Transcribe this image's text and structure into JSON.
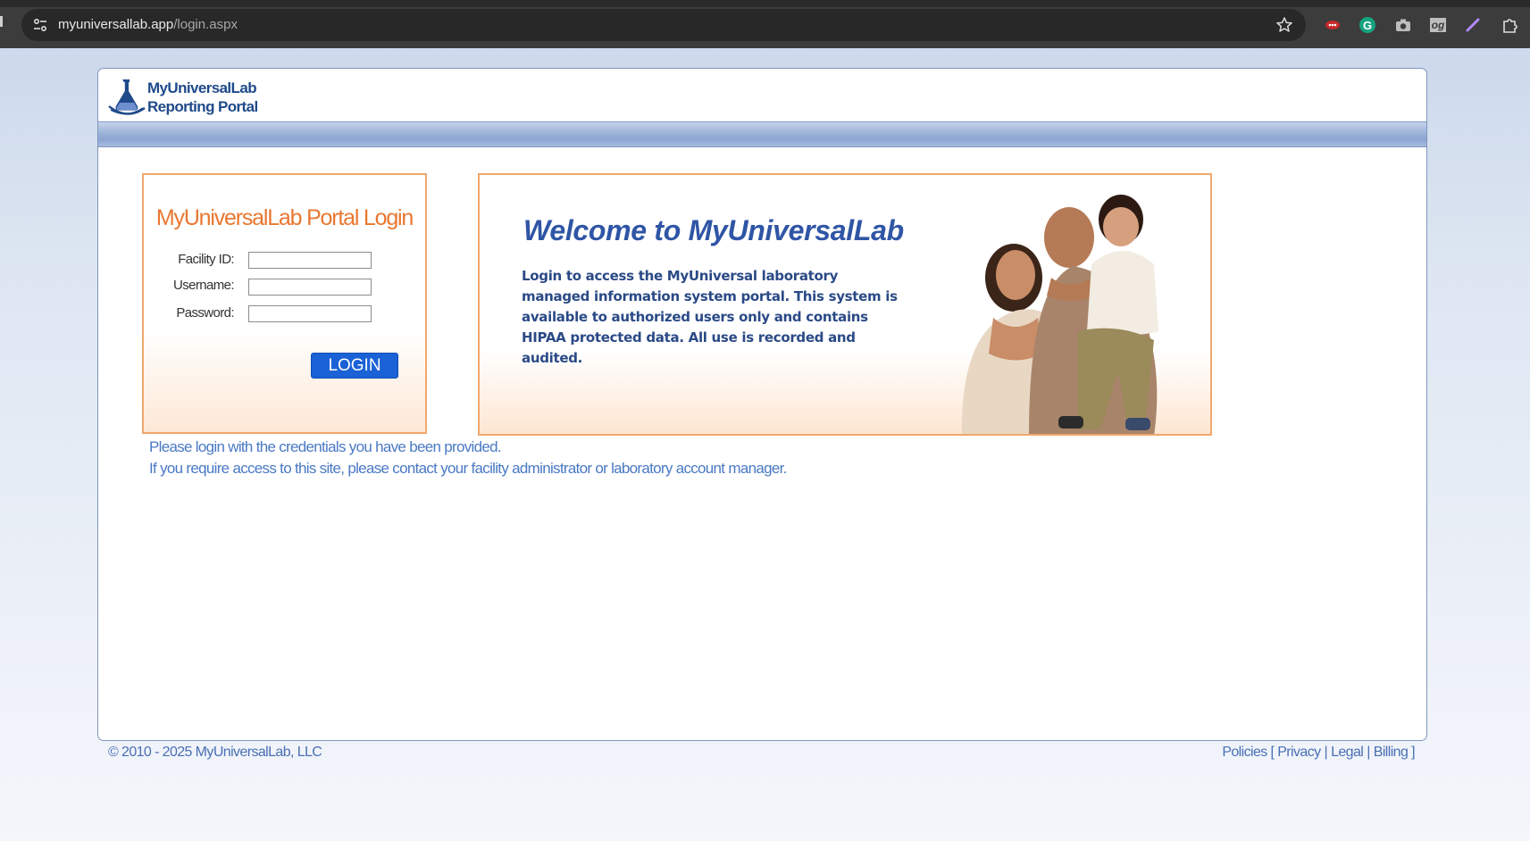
{
  "browser": {
    "url_domain": "myuniversallab.app",
    "url_path": "/login.aspx",
    "extensions": [
      "lastpass-icon",
      "grammarly-icon",
      "camera-icon",
      "og-icon",
      "pen-icon",
      "puzzle-icon"
    ],
    "og_label": "og"
  },
  "logo": {
    "line1": "MyUniversalLab",
    "line2": "Reporting Portal"
  },
  "login": {
    "title": "MyUniversalLab Portal Login",
    "facility_label": "Facility ID:",
    "username_label": "Username:",
    "password_label": "Password:",
    "facility_value": "",
    "username_value": "",
    "password_value": "",
    "button_label": "LOGIN"
  },
  "welcome": {
    "title": "Welcome to MyUniversalLab",
    "text": "Login to access the MyUniversal laboratory managed information system portal. This system is available to authorized users only and contains HIPAA protected data. All use is recorded and audited."
  },
  "notes": {
    "line1": "Please login with the credentials you have been provided.",
    "line2": "If you require access to this site, please contact your facility administrator or laboratory account manager."
  },
  "footer": {
    "copyright": "© 2010 - 2025  MyUniversalLab, LLC",
    "policies_label": "Policies",
    "open_bracket": "[",
    "privacy": "Privacy",
    "legal": "Legal",
    "billing": "Billing",
    "close_bracket": "]"
  },
  "colors": {
    "accent_orange": "#f1a76c",
    "title_blue": "#2f55a5",
    "button_blue": "#1a62d6"
  }
}
